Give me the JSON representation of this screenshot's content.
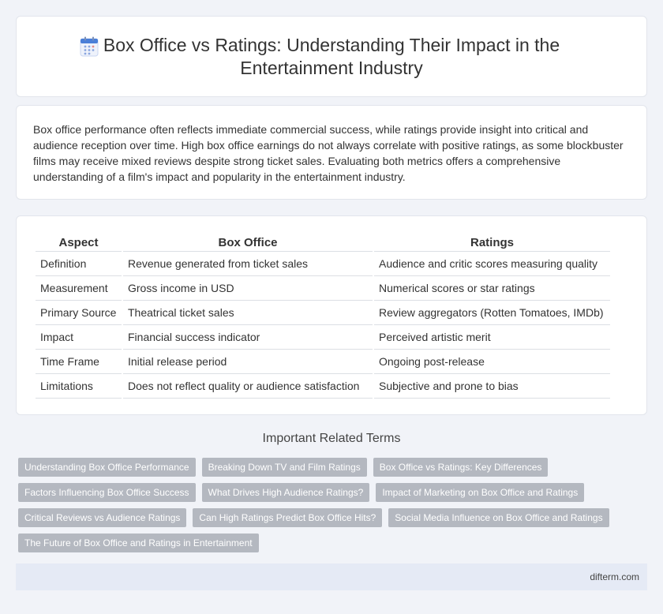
{
  "header": {
    "title": "Box Office vs Ratings: Understanding Their Impact in the Entertainment Industry"
  },
  "intro": {
    "text": "Box office performance often reflects immediate commercial success, while ratings provide insight into critical and audience reception over time. High box office earnings do not always correlate with positive ratings, as some blockbuster films may receive mixed reviews despite strong ticket sales. Evaluating both metrics offers a comprehensive understanding of a film's impact and popularity in the entertainment industry."
  },
  "table": {
    "headers": [
      "Aspect",
      "Box Office",
      "Ratings"
    ],
    "rows": [
      [
        "Definition",
        "Revenue generated from ticket sales",
        "Audience and critic scores measuring quality"
      ],
      [
        "Measurement",
        "Gross income in USD",
        "Numerical scores or star ratings"
      ],
      [
        "Primary Source",
        "Theatrical ticket sales",
        "Review aggregators (Rotten Tomatoes, IMDb)"
      ],
      [
        "Impact",
        "Financial success indicator",
        "Perceived artistic merit"
      ],
      [
        "Time Frame",
        "Initial release period",
        "Ongoing post-release"
      ],
      [
        "Limitations",
        "Does not reflect quality or audience satisfaction",
        "Subjective and prone to bias"
      ]
    ]
  },
  "related": {
    "heading": "Important Related Terms",
    "tags": [
      [
        "Understanding Box Office Performance",
        "Breaking Down TV and Film Ratings",
        "Box Office vs Ratings: Key Differences"
      ],
      [
        "Factors Influencing Box Office Success",
        "What Drives High Audience Ratings?",
        "Impact of Marketing on Box Office and Ratings"
      ],
      [
        "Critical Reviews vs Audience Ratings",
        "Can High Ratings Predict Box Office Hits?",
        "Social Media Influence on Box Office and Ratings"
      ],
      [
        "The Future of Box Office and Ratings in Entertainment"
      ]
    ]
  },
  "footer": {
    "site": "difterm.com"
  },
  "icons": {
    "title_icon": "calendar-icon"
  },
  "colors": {
    "background": "#f1f3f8",
    "tag_bg": "#b4b8c0",
    "footer_bg": "#e5eaf5",
    "icon_top": "#4a7fd8",
    "icon_dots": "#8aa6e0"
  }
}
